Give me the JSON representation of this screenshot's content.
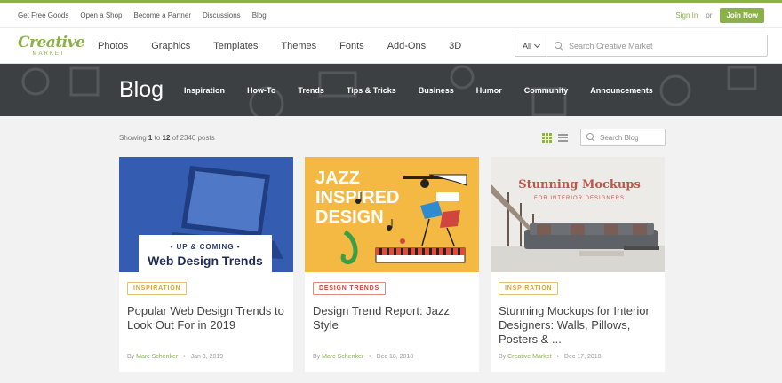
{
  "colors": {
    "brand_green": "#8cb14a",
    "banner_dark": "#3d4043",
    "tag_gold": "#d8a63a",
    "tag_red": "#d0463e"
  },
  "utility": {
    "links": [
      "Get Free Goods",
      "Open a Shop",
      "Become a Partner",
      "Discussions",
      "Blog"
    ],
    "sign_in": "Sign In",
    "or": "or",
    "join_now": "Join Now"
  },
  "header": {
    "logo_line1": "Creative",
    "logo_line2": "MARKET",
    "nav": [
      "Photos",
      "Graphics",
      "Templates",
      "Themes",
      "Fonts",
      "Add-Ons",
      "3D"
    ],
    "search": {
      "category": "All",
      "placeholder": "Search Creative Market"
    }
  },
  "blog": {
    "title": "Blog",
    "nav": [
      "Inspiration",
      "How-To",
      "Trends",
      "Tips & Tricks",
      "Business",
      "Humor",
      "Community",
      "Announcements"
    ],
    "results": {
      "prefix": "Showing",
      "from": "1",
      "to_word": "to",
      "to": "12",
      "of_word": "of",
      "total": "2340 posts"
    },
    "search_placeholder": "Search Blog"
  },
  "cards": [
    {
      "tag": "INSPIRATION",
      "title": "Popular Web Design Trends to Look Out For in 2019",
      "by": "By",
      "author": "Marc Schenker",
      "date": "Jan 3, 2019",
      "image_text": {
        "line1": "• UP & COMING •",
        "line2": "Web Design Trends"
      }
    },
    {
      "tag": "DESIGN TRENDS",
      "title": "Design Trend Report: Jazz Style",
      "by": "By",
      "author": "Marc Schenker",
      "date": "Dec 18, 2018",
      "image_text": {
        "line1": "JAZZ",
        "line2": "INSPIRED",
        "line3": "DESIGN"
      }
    },
    {
      "tag": "INSPIRATION",
      "title": "Stunning Mockups for Interior Designers: Walls, Pillows, Posters & ...",
      "by": "By",
      "author": "Creative Market",
      "date": "Dec 17, 2018",
      "image_text": {
        "line1": "Stunning Mockups",
        "line2": "FOR INTERIOR DESIGNERS"
      }
    }
  ]
}
